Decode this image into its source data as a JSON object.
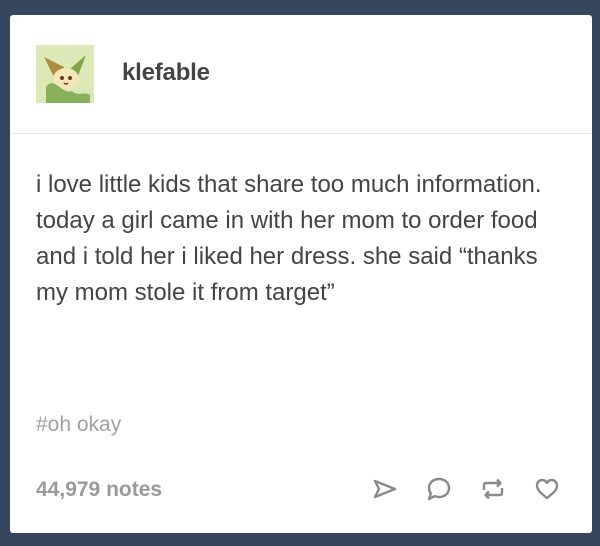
{
  "post": {
    "username": "klefable",
    "body": "i love little kids that share too much information. today a girl came in with her mom to order food and i told her i liked her dress. she said “thanks my mom stole it from target”",
    "tags": [
      "#oh okay"
    ],
    "notes": "44,979 notes",
    "actions": [
      "share-icon",
      "reply-icon",
      "reblog-icon",
      "like-icon"
    ]
  },
  "colors": {
    "background": "#36465d",
    "card": "#ffffff",
    "text": "#444444",
    "muted": "#9a9a9a",
    "icon": "#9a9a9a"
  }
}
